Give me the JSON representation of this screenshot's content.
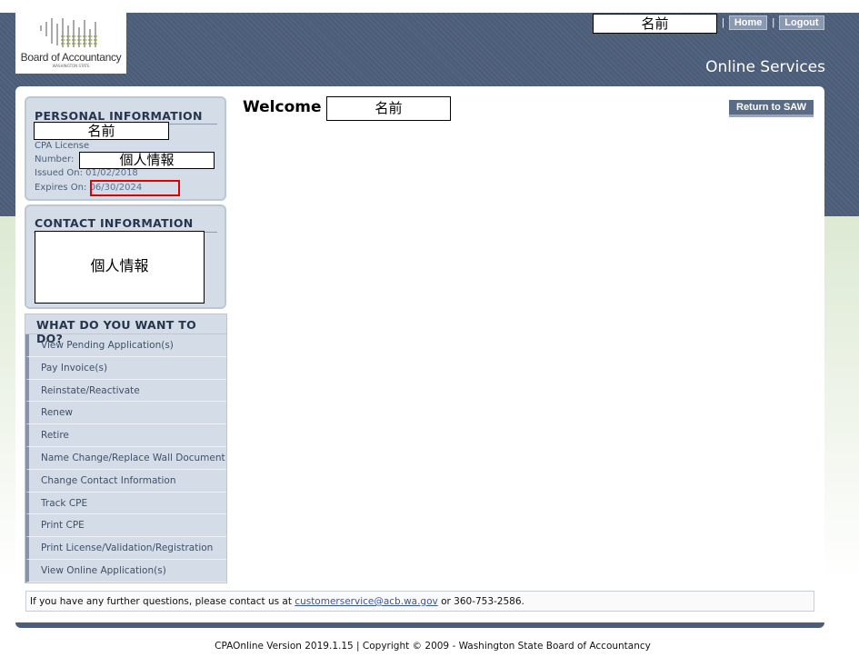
{
  "logo": {
    "name": "Board of Accountancy",
    "sub": "WASHINGTON STATE"
  },
  "topbar": {
    "user_name": "名前",
    "home": "Home",
    "logout": "Logout",
    "separator": "|",
    "title": "Online Services"
  },
  "personal": {
    "heading": "PERSONAL INFORMATION",
    "name": "名前",
    "license_label_1": "CPA License",
    "license_label_2": "Number:",
    "license_number": "個人情報",
    "issued_label": "Issued On:",
    "issued_value": "01/02/2018",
    "expires_label": "Expires On:",
    "expires_value": "06/30/2024"
  },
  "contact": {
    "heading": "CONTACT INFORMATION",
    "details": "個人情報"
  },
  "menu": {
    "heading": "WHAT DO YOU WANT TO DO?",
    "items": [
      "View Pending Application(s)",
      "Pay Invoice(s)",
      "Reinstate/Reactivate",
      "Renew",
      "Retire",
      "Name Change/Replace Wall Document",
      "Change Contact Information",
      "Track CPE",
      "Print CPE",
      "Print License/Validation/Registration",
      "View Online Application(s)"
    ]
  },
  "main": {
    "welcome": "Welcome",
    "welcome_name": "名前",
    "return_button": "Return to SAW"
  },
  "footer": {
    "note_prefix": "If you have any further questions, please contact us at ",
    "email": "customerservice@acb.wa.gov",
    "note_suffix": " or 360-753-2586.",
    "copyright": "CPAOnline Version 2019.1.15 | Copyright © 2009 - Washington State Board of Accountancy"
  },
  "colors": {
    "header": "#4b5d78",
    "panel": "#d4dde7",
    "highlight": "#e00000"
  }
}
